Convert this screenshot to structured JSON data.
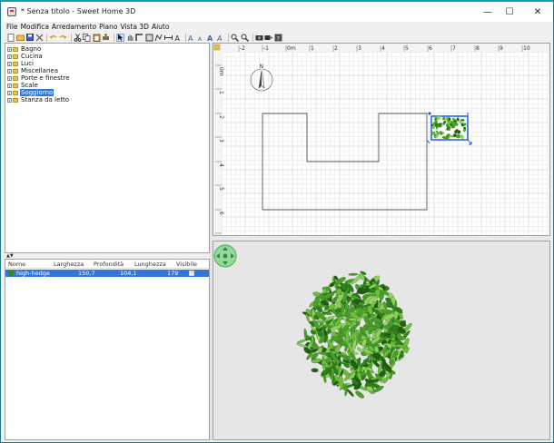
{
  "window": {
    "title": "* Senza titolo - Sweet Home 3D",
    "minimize": "—",
    "maximize": "☐",
    "close": "✕"
  },
  "menu": [
    "File",
    "Modifica",
    "Arredamento",
    "Piano",
    "Vista 3D",
    "Aiuto"
  ],
  "toolbar_icons": [
    "new-file-icon",
    "open-icon",
    "save-icon",
    "cut-icon",
    "undo-icon",
    "redo-icon",
    "scissors-icon",
    "copy-icon",
    "paste-icon",
    "add-furniture-icon",
    "select-icon",
    "pan-icon",
    "create-walls-icon",
    "create-rooms-icon",
    "create-polylines-icon",
    "create-dimensions-icon",
    "create-labels-icon",
    "text-style-icon",
    "zoom-in-icon",
    "zoom-out-icon",
    "create-photo-icon",
    "create-video-icon",
    "help-icon"
  ],
  "catalog": {
    "categories": [
      {
        "label": "Bagno",
        "selected": false
      },
      {
        "label": "Cucina",
        "selected": false
      },
      {
        "label": "Luci",
        "selected": false
      },
      {
        "label": "Miscellanea",
        "selected": false
      },
      {
        "label": "Porte e finestre",
        "selected": false
      },
      {
        "label": "Scale",
        "selected": false
      },
      {
        "label": "Soggiorno",
        "selected": true
      },
      {
        "label": "Stanza da letto",
        "selected": false
      }
    ]
  },
  "furniture_table": {
    "columns": [
      "Nome",
      "Larghezza",
      "Profondità",
      "Lunghezza",
      "Visibile"
    ],
    "rows": [
      {
        "name": "high-hedge",
        "width": "150,7",
        "depth": "104,1",
        "height": "179",
        "visible": true
      }
    ]
  },
  "plan": {
    "ruler_x": [
      "-2",
      "-1",
      "0m",
      "1",
      "2",
      "3",
      "4",
      "5",
      "6",
      "7",
      "8",
      "9",
      "10"
    ],
    "ruler_y": [
      "0m",
      "1",
      "2",
      "3",
      "4",
      "5",
      "6",
      "7"
    ],
    "compass_label": "N",
    "colors": {
      "grid_minor": "#e6e6e6",
      "grid_major": "#c8c8c8",
      "wall": "#555555",
      "selection": "#1e5bd6"
    }
  },
  "view3d": {
    "navigator_color": "#3fb04a",
    "foliage_colors": [
      "#1f5f12",
      "#2f7f1c",
      "#4a9e2a",
      "#6cbf3a",
      "#8fd45a"
    ]
  }
}
